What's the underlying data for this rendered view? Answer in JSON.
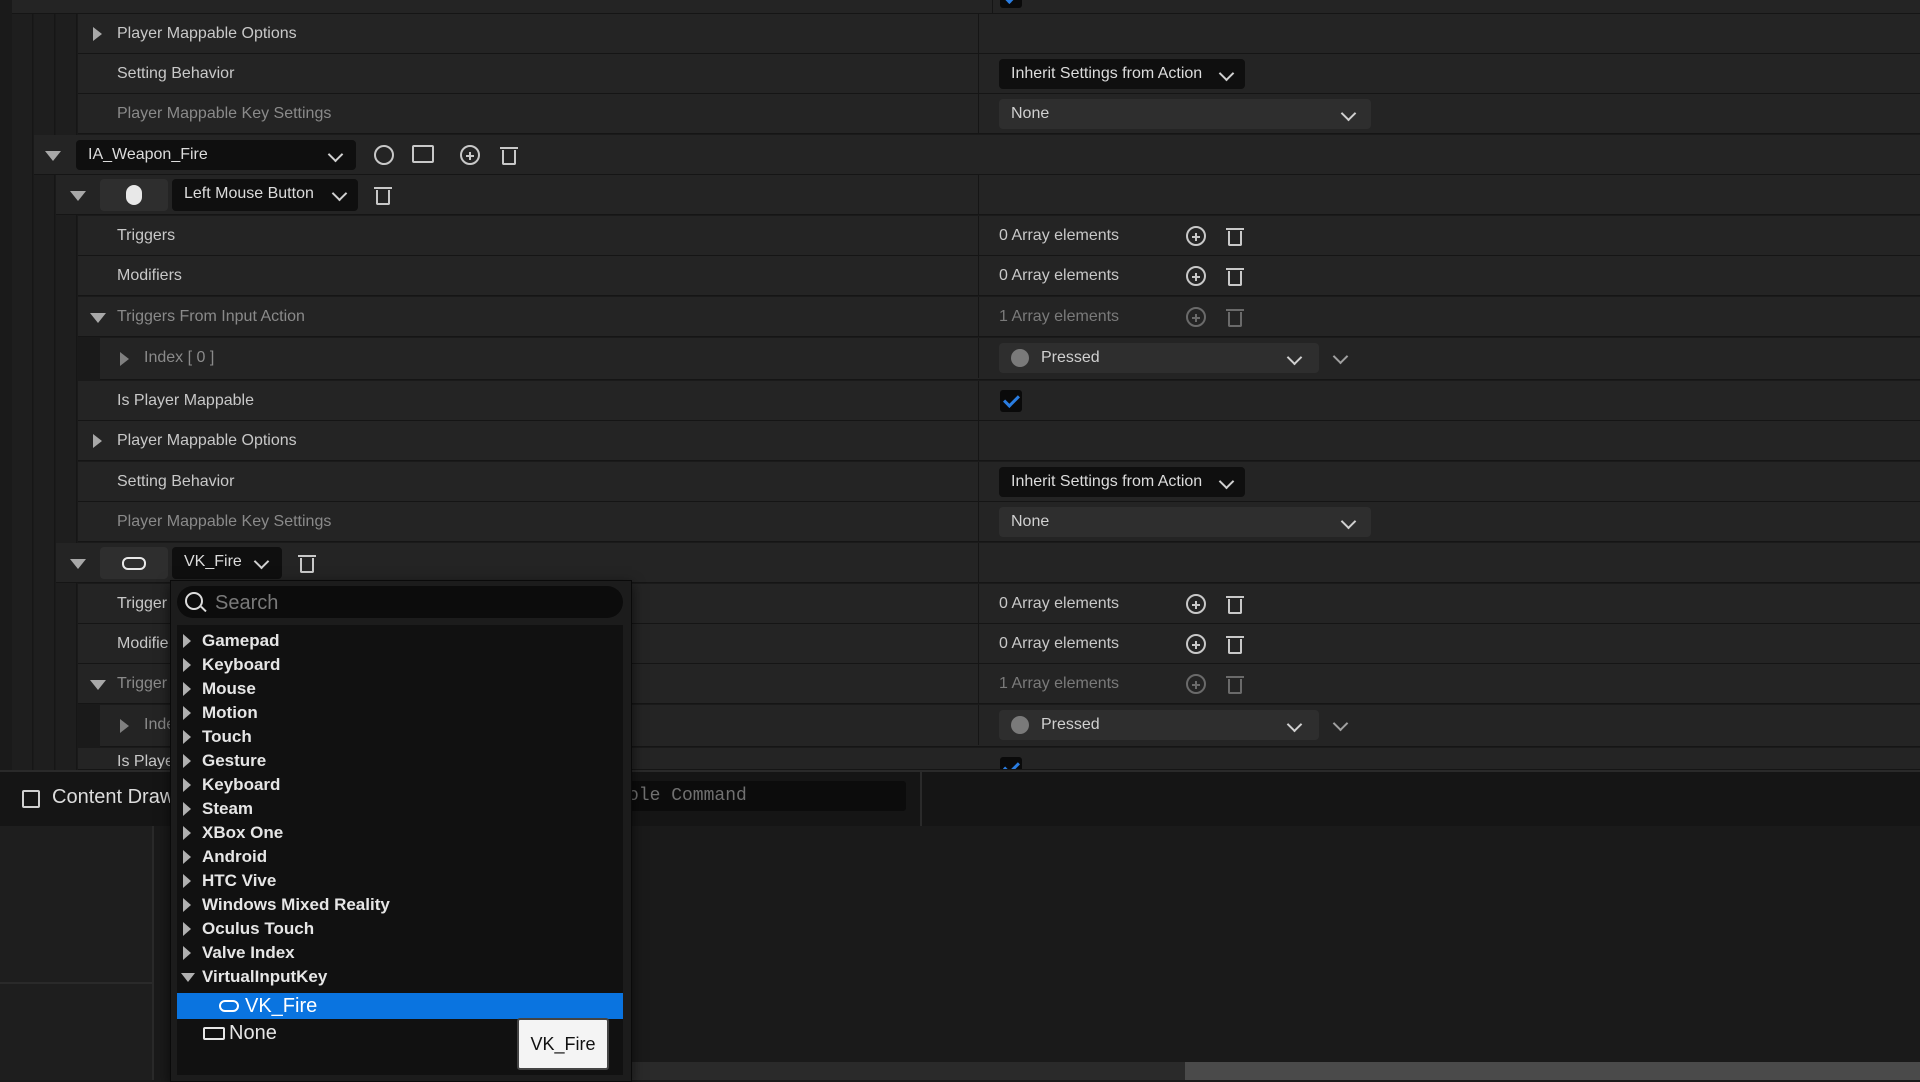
{
  "rows": {
    "player_mappable_options_1": "Player Mappable Options",
    "setting_behavior_1": "Setting Behavior",
    "setting_behavior_value_1": "Inherit Settings from Action",
    "player_mappable_key_settings_1": "Player Mappable Key Settings",
    "player_mappable_key_settings_value_1": "None",
    "action_name": "IA_Weapon_Fire",
    "mapping1_key": "Left Mouse Button",
    "triggers": "Triggers",
    "modifiers": "Modifiers",
    "triggers_from_input_action": "Triggers From Input Action",
    "index_0": "Index [ 0 ]",
    "array_0": "0 Array elements",
    "array_1": "1 Array elements",
    "pressed": "Pressed",
    "is_player_mappable": "Is Player Mappable",
    "player_mappable_options_2": "Player Mappable Options",
    "setting_behavior_2": "Setting Behavior",
    "setting_behavior_value_2": "Inherit Settings from Action",
    "player_mappable_key_settings_2": "Player Mappable Key Settings",
    "player_mappable_key_settings_value_2": "None",
    "mapping2_key": "VK_Fire",
    "triggers_partial": "Trigger",
    "modifiers_partial": "Modifie",
    "triggers_from_partial": "Trigger",
    "index_partial": "Inde",
    "is_player_partial": "Is Playe"
  },
  "bottom": {
    "content_drawer": "Content Draw",
    "console_placeholder": "ole Command"
  },
  "popup": {
    "search_placeholder": "Search",
    "categories": [
      "Gamepad",
      "Keyboard",
      "Mouse",
      "Motion",
      "Touch",
      "Gesture",
      "Keyboard",
      "Steam",
      "XBox One",
      "Android",
      "HTC Vive",
      "Windows Mixed Reality",
      "Oculus Touch",
      "Valve Index",
      "VirtualInputKey"
    ],
    "selected": "VK_Fire",
    "none": "None",
    "tooltip": "VK_Fire"
  }
}
